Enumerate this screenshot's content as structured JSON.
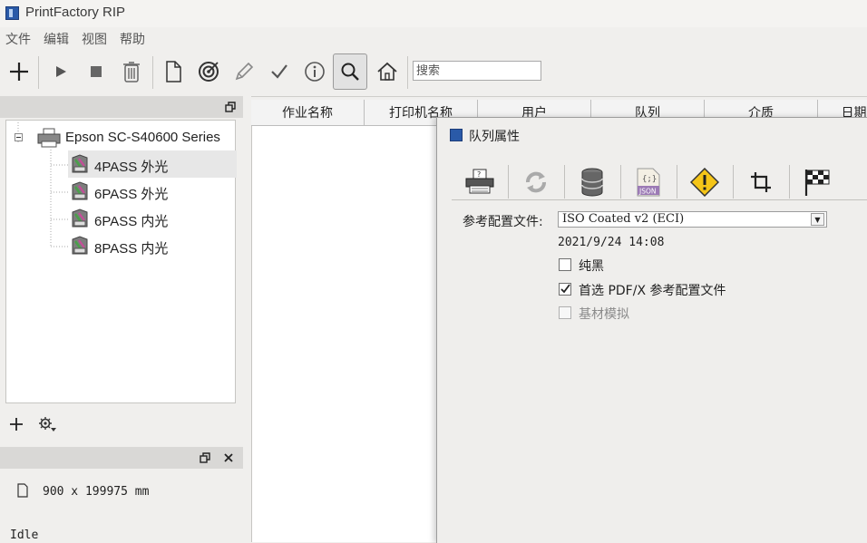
{
  "app": {
    "title": "PrintFactory RIP"
  },
  "menu": [
    "文件",
    "编辑",
    "视图",
    "帮助"
  ],
  "toolbar": {
    "buttons": [
      "add-icon",
      "play-icon",
      "stop-icon",
      "trash-icon",
      "document-icon",
      "target-icon",
      "pencil-icon",
      "checkmark-icon",
      "info-icon",
      "search-icon",
      "home-icon"
    ],
    "active": "search-icon",
    "search_placeholder": "搜索"
  },
  "tree": {
    "printer": "Epson SC-S40600 Series",
    "queues": [
      "4PASS 外光",
      "6PASS 外光",
      "6PASS 内光",
      "8PASS 内光"
    ],
    "selected_index": 0
  },
  "left_bottom": {
    "size": "900 x 199975 mm",
    "status": "Idle"
  },
  "job_table": {
    "columns": [
      "作业名称",
      "打印机名称",
      "用户",
      "队列",
      "介质",
      "日期"
    ]
  },
  "dialog": {
    "title": "队列属性",
    "tabs": [
      "printer-settings-icon",
      "refresh-icon",
      "database-icon",
      "json-icon",
      "warning-icon",
      "crop-icon",
      "checkered-flag-icon"
    ],
    "json_tab_text": "JSON",
    "profile_label": "参考配置文件:",
    "profile_value": "ISO Coated v2 (ECI)",
    "profile_date": "2021/9/24 14:08",
    "checkboxes": [
      {
        "label": "纯黑",
        "checked": false,
        "enabled": true
      },
      {
        "label": "首选 PDF/X 参考配置文件",
        "checked": true,
        "enabled": true
      },
      {
        "label": "基材模拟",
        "checked": false,
        "enabled": false
      }
    ]
  },
  "colors": {
    "accent": "#2a5aa8",
    "warning": "#f5c518"
  }
}
